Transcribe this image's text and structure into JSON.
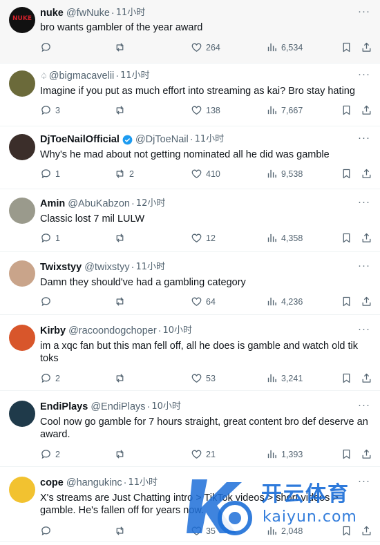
{
  "tweets": [
    {
      "name": "nuke",
      "handle": "@fwNuke",
      "time": "11小时",
      "text": "bro wants gambler of the year award",
      "replies": "",
      "retweets": "",
      "likes": "264",
      "views": "6,534",
      "avatar_color": "#111111",
      "avatar_label": "NUKE"
    },
    {
      "name": "",
      "handle": "@bigmacavelii",
      "time": "11小时",
      "text": "Imagine if you put as much effort into streaming as kai? Bro stay hating",
      "replies": "3",
      "retweets": "",
      "likes": "138",
      "views": "7,667",
      "avatar_color": "#6b6a3a"
    },
    {
      "name": "DjToeNailOfficial",
      "handle": "@DjToeNail",
      "time": "11小时",
      "text": "Why's he mad about not getting nominated all he did was gamble",
      "replies": "1",
      "retweets": "2",
      "likes": "410",
      "views": "9,538",
      "avatar_color": "#3b2e2a"
    },
    {
      "name": "Amin",
      "handle": "@AbuKabzon",
      "time": "12小时",
      "text": "Classic lost 7 mil LULW",
      "replies": "1",
      "retweets": "",
      "likes": "12",
      "views": "4,358",
      "avatar_color": "#9a9a8c"
    },
    {
      "name": "Twixstyy",
      "handle": "@twixstyy",
      "time": "11小时",
      "text": "Damn they should've had a gambling category",
      "replies": "",
      "retweets": "",
      "likes": "64",
      "views": "4,236",
      "avatar_color": "#c9a48a"
    },
    {
      "name": "Kirby",
      "handle": "@racoondogchoper",
      "time": "10小时",
      "text": "im a xqc fan but this man fell off, all he does is gamble and watch old tik toks",
      "replies": "2",
      "retweets": "",
      "likes": "53",
      "views": "3,241",
      "avatar_color": "#d8562b"
    },
    {
      "name": "EndiPlays",
      "handle": "@EndiPlays",
      "time": "10小时",
      "text": "Cool now go gamble for 7 hours straight, great content bro def deserve an award.",
      "replies": "2",
      "retweets": "",
      "likes": "21",
      "views": "1,393",
      "avatar_color": "#1f3a4a"
    },
    {
      "name": "cope",
      "handle": "@hangukinc",
      "time": "11小时",
      "text": "X's streams are Just Chatting intro > TikTok videos > short videos > gamble. He's fallen off for years now.",
      "replies": "",
      "retweets": "",
      "likes": "35",
      "views": "2,048",
      "avatar_color": "#f2c230"
    }
  ],
  "watermark": {
    "brand": "开云体育",
    "url": "kaiyun.com"
  },
  "colors": {
    "text": "#0f1419",
    "muted": "#536471",
    "verified": "#1d9bf0",
    "watermark": "#1d6fd8"
  }
}
